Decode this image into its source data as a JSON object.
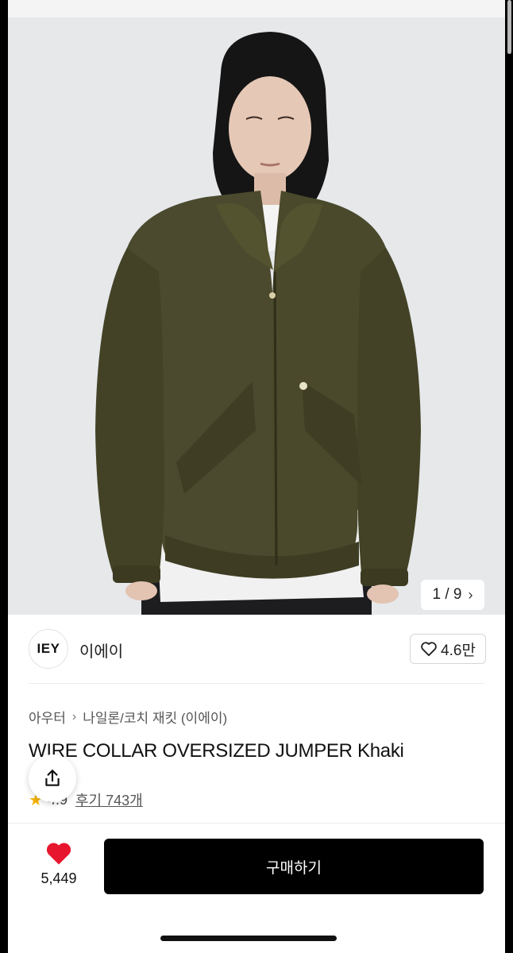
{
  "product": {
    "image_counter": "1 / 9",
    "brand_logo_text": "IEY",
    "brand_name": "이에이",
    "brand_likes": "4.6만",
    "breadcrumb": [
      "아우터",
      "나일론/코치 재킷 (이에이)"
    ],
    "title": "WIRE COLLAR OVERSIZED JUMPER Khaki",
    "rating": "4.9",
    "reviews": "후기 743개"
  },
  "bottom_bar": {
    "like_count": "5,449",
    "buy_label": "구매하기"
  },
  "colors": {
    "heart": "#e8152e",
    "buy_button": "#000000",
    "star": "#f5b301"
  }
}
